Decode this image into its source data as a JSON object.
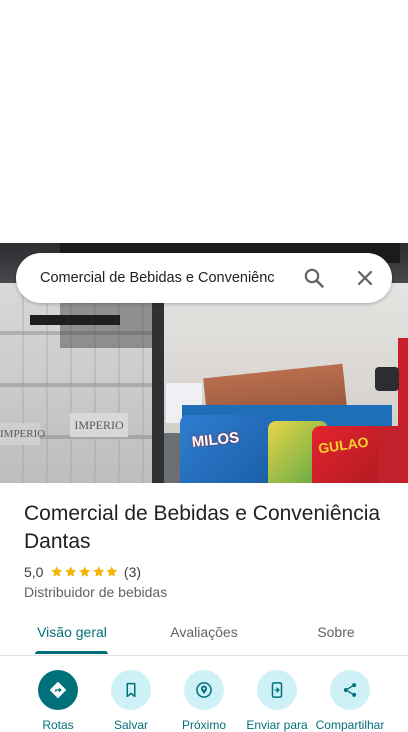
{
  "search": {
    "query": "Comercial de Bebidas e Conveniênc"
  },
  "photo": {
    "sign_text_1": "IMPERIO",
    "sign_text_2": "IMPERIO",
    "bag_text_1": "MILOS",
    "bag_text_2": "GULAO"
  },
  "place": {
    "name": "Comercial de Bebidas e Conveniência Dantas",
    "rating": "5,0",
    "stars": 5,
    "review_count": "(3)",
    "category": "Distribuidor de bebidas"
  },
  "tabs": [
    {
      "label": "Visão geral",
      "active": true
    },
    {
      "label": "Avaliações",
      "active": false
    },
    {
      "label": "Sobre",
      "active": false
    }
  ],
  "actions": [
    {
      "label": "Rotas",
      "icon": "directions-icon"
    },
    {
      "label": "Salvar",
      "icon": "bookmark-icon"
    },
    {
      "label": "Próximo",
      "icon": "nearby-icon"
    },
    {
      "label": "Enviar para",
      "icon": "send-to-phone-icon"
    },
    {
      "label": "Compartilhar",
      "icon": "share-icon"
    }
  ],
  "colors": {
    "accent": "#00707a",
    "action_bg": "#cdf1f6",
    "star": "#f4b400"
  }
}
